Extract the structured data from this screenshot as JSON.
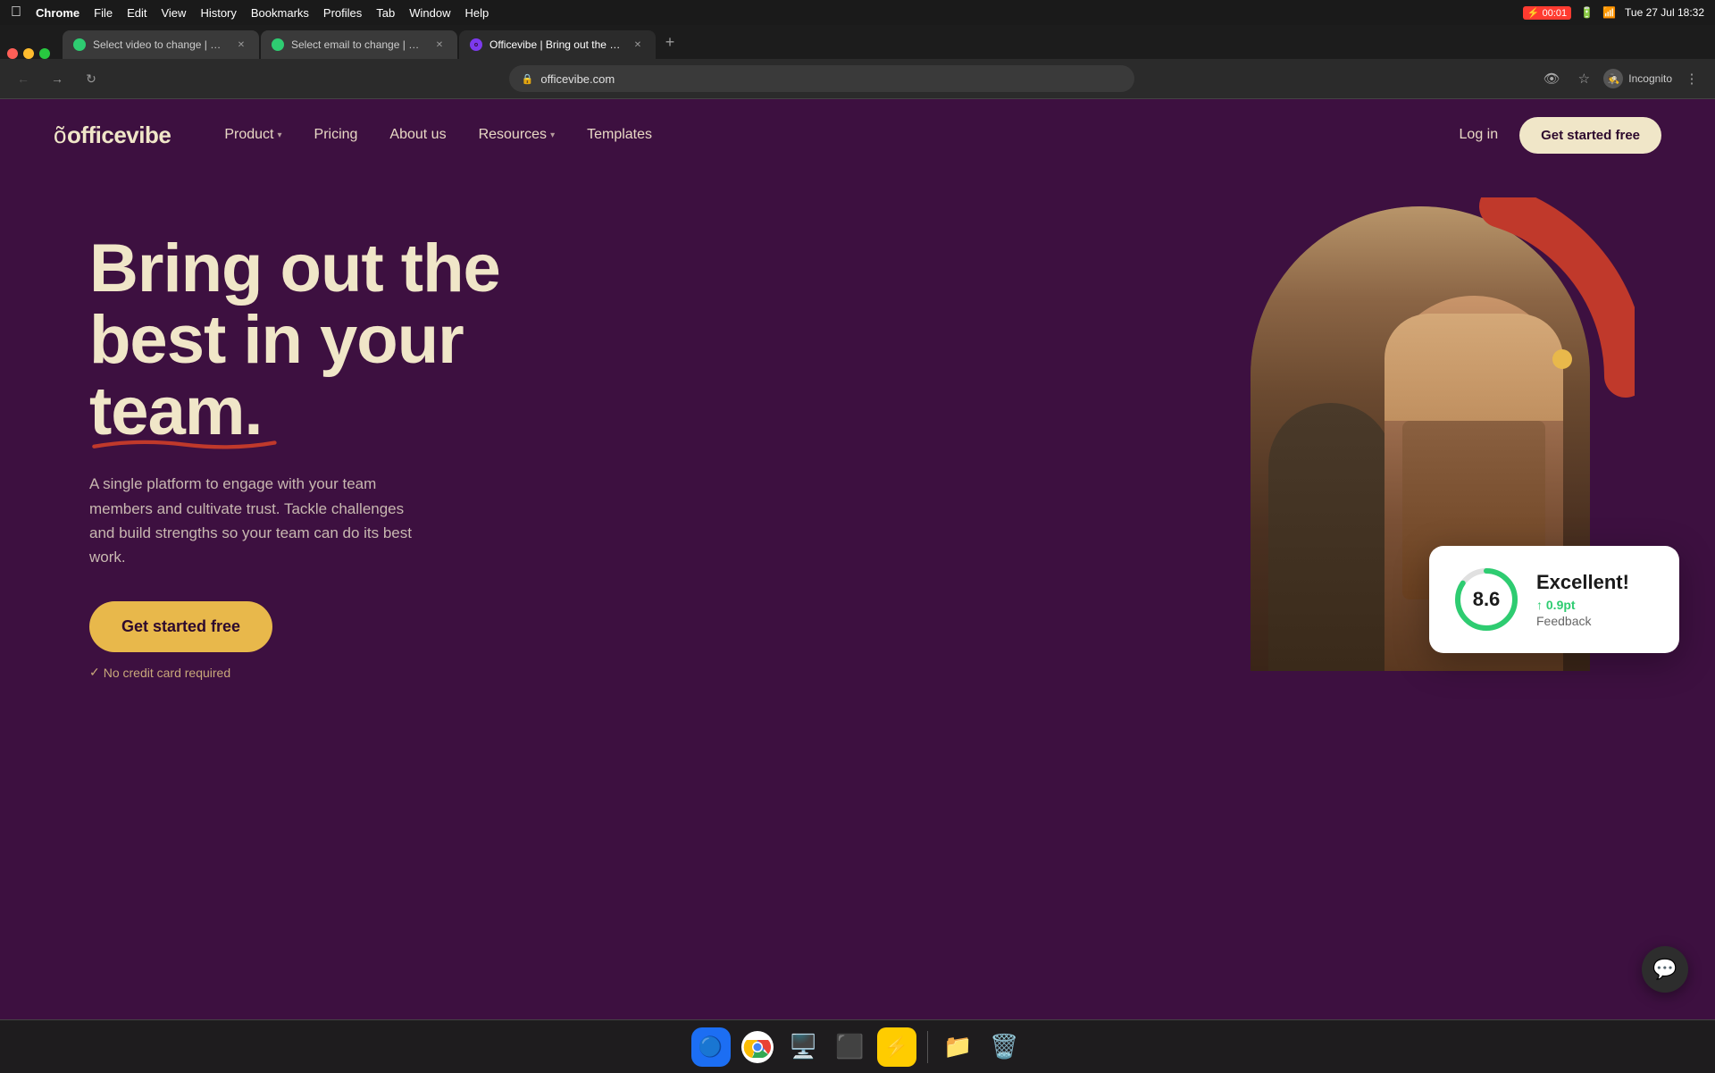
{
  "macos": {
    "menubar": {
      "apple": "🍎",
      "appName": "Chrome",
      "menus": [
        "File",
        "Edit",
        "View",
        "History",
        "Bookmarks",
        "Profiles",
        "Tab",
        "Window",
        "Help"
      ],
      "time": "Tue 27 Jul  18:32",
      "batteryTime": "00:01"
    }
  },
  "browser": {
    "tabs": [
      {
        "id": "tab1",
        "title": "Select video to change | Djang...",
        "favicon": "green",
        "active": false
      },
      {
        "id": "tab2",
        "title": "Select email to change | Djang...",
        "favicon": "green",
        "active": false
      },
      {
        "id": "tab3",
        "title": "Officevibe | Bring out the best...",
        "favicon": "purple",
        "active": true
      }
    ],
    "url": "officevibe.com",
    "incognito_label": "Incognito"
  },
  "nav": {
    "logo": "officevibe",
    "links": [
      {
        "label": "Product",
        "hasDropdown": true
      },
      {
        "label": "Pricing",
        "hasDropdown": false
      },
      {
        "label": "About us",
        "hasDropdown": false
      },
      {
        "label": "Resources",
        "hasDropdown": true
      },
      {
        "label": "Templates",
        "hasDropdown": false
      }
    ],
    "login": "Log in",
    "cta": "Get started free"
  },
  "hero": {
    "headline_line1": "Bring out the",
    "headline_line2": "best in your",
    "headline_line3": "team.",
    "description": "A single platform to engage with your team members and cultivate trust. Tackle challenges and build strengths so your team can do its best work.",
    "cta_button": "Get started free",
    "no_credit_card": "No credit card required"
  },
  "score_card": {
    "score": "8.6",
    "label": "Excellent!",
    "change": "↑ 0.9pt",
    "category": "Feedback"
  },
  "colors": {
    "bg": "#3d1040",
    "accent_yellow": "#e8b84b",
    "accent_red": "#c0392b",
    "text_light": "#f0e6c8",
    "text_muted": "#c8b8b0",
    "score_green": "#2ecc71"
  }
}
